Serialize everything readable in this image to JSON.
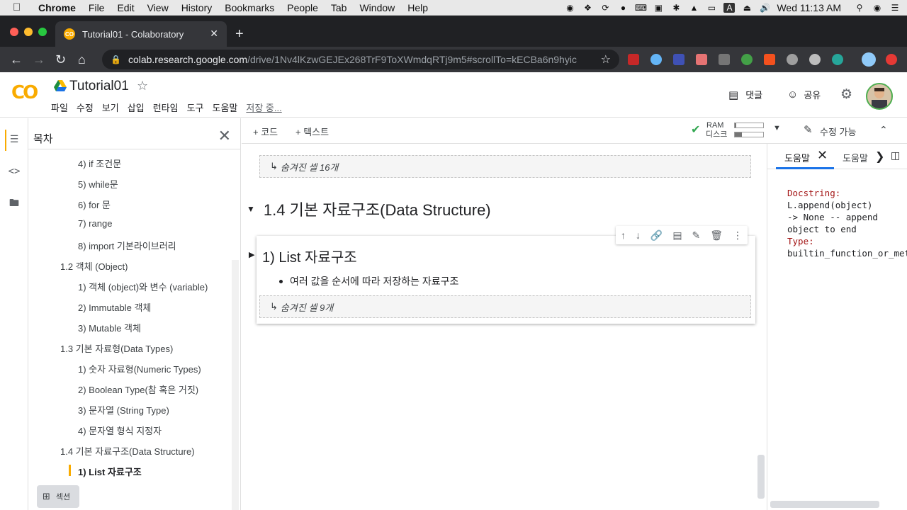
{
  "menubar": {
    "app": "Chrome",
    "items": [
      "File",
      "Edit",
      "View",
      "History",
      "Bookmarks",
      "People",
      "Tab",
      "Window",
      "Help"
    ],
    "input_source": "A",
    "clock": "Wed 11:13 AM"
  },
  "browser": {
    "tab_title": "Tutorial01 - Colaboratory",
    "tab_favicon": "CO",
    "url_host": "colab.research.google.com",
    "url_path": "/drive/1Nv4lKzwGEJEx268TrF9ToXWmdqRTj9m5#scrollTo=kECBa6n9hyic"
  },
  "colab": {
    "logo": "CO",
    "notebook_title": "Tutorial01",
    "menus": [
      "파일",
      "수정",
      "보기",
      "삽입",
      "런타임",
      "도구",
      "도움말"
    ],
    "saving_status": "저장 중...",
    "comments_label": "댓글",
    "share_label": "공유"
  },
  "toc": {
    "title": "목차",
    "items": [
      {
        "label": "4) if 조건문",
        "level": 2
      },
      {
        "label": "5) while문",
        "level": 2
      },
      {
        "label": "6) for 문",
        "level": 2
      },
      {
        "label": "7) range",
        "level": 2
      },
      {
        "label": "8) import 기본라이브러리",
        "level": 2
      },
      {
        "label": "1.2 객체 (Object)",
        "level": 1
      },
      {
        "label": "1) 객체 (object)와 변수 (variable)",
        "level": 2
      },
      {
        "label": "2) Immutable 객체",
        "level": 2
      },
      {
        "label": "3) Mutable 객체",
        "level": 2
      },
      {
        "label": "1.3 기본 자료형(Data Types)",
        "level": 1
      },
      {
        "label": "1) 숫자 자료형(Numeric Types)",
        "level": 2
      },
      {
        "label": "2) Boolean Type(참 혹은 거짓)",
        "level": 2
      },
      {
        "label": "3) 문자열 (String Type)",
        "level": 2
      },
      {
        "label": "4) 문자열 형식 지정자",
        "level": 2
      },
      {
        "label": "1.4 기본 자료구조(Data Structure)",
        "level": 1
      },
      {
        "label": "1) List 자료구조",
        "level": 2,
        "active": true
      }
    ],
    "section_button": "섹션"
  },
  "notebook_toolbar": {
    "add_code": "+ 코드",
    "add_text": "+ 텍스트",
    "ram_label": "RAM",
    "disk_label": "디스크",
    "ram_usage": 0.05,
    "disk_usage": 0.25,
    "edit_mode": "수정 가능"
  },
  "notebook": {
    "hidden_cells_top": "숨겨진 셀 16개",
    "section_heading": "1.4 기본 자료구조(Data Structure)",
    "cell_title": "1) List 자료구조",
    "cell_bullet": "여러 값을 순서에 따라 저장하는 자료구조",
    "hidden_cells_cell": "숨겨진 셀 9개"
  },
  "help_panel": {
    "tab1": "도움말",
    "tab2": "도움말",
    "docstring_label": "Docstring:",
    "docstring_lines": [
      "L.append(object)",
      "-> None -- append",
      "object to end"
    ],
    "type_label": "Type:",
    "type_value": "builtin_function_or_method"
  },
  "colors": {
    "accent": "#f9ab00",
    "link": "#1a73e8",
    "chrome_dark": "#202124",
    "chrome_toolbar": "#35363a"
  }
}
